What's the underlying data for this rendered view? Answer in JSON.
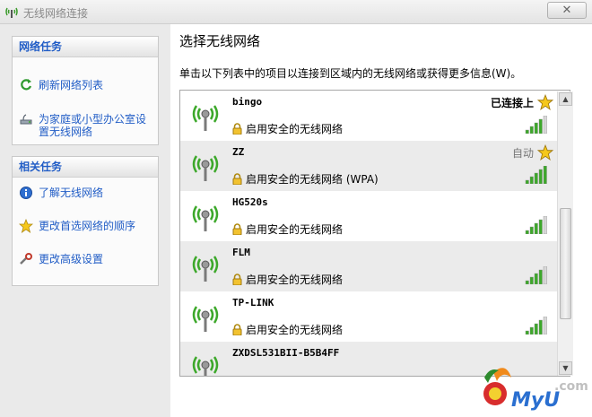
{
  "window": {
    "title": "无线网络连接",
    "close_label": "✕"
  },
  "sidebar": {
    "network_tasks": {
      "heading": "网络任务",
      "items": [
        {
          "label": "刷新网络列表",
          "icon": "refresh-icon"
        },
        {
          "label": "为家庭或小型办公室设置无线网络",
          "icon": "setup-network-icon"
        }
      ]
    },
    "related_tasks": {
      "heading": "相关任务",
      "items": [
        {
          "label": "了解无线网络",
          "icon": "info-icon"
        },
        {
          "label": "更改首选网络的顺序",
          "icon": "star-icon"
        },
        {
          "label": "更改高级设置",
          "icon": "settings-icon"
        }
      ]
    }
  },
  "main": {
    "heading": "选择无线网络",
    "description": "单击以下列表中的项目以连接到区域内的无线网络或获得更多信息(W)。",
    "networks": [
      {
        "ssid": "bingo",
        "security": "启用安全的无线网络",
        "status": "已连接上",
        "starred": true,
        "signal": 4
      },
      {
        "ssid": "ZZ",
        "security": "启用安全的无线网络 (WPA)",
        "status": "自动",
        "starred": true,
        "signal": 5
      },
      {
        "ssid": "HG520s",
        "security": "启用安全的无线网络",
        "status": "",
        "starred": false,
        "signal": 4
      },
      {
        "ssid": "FLM",
        "security": "启用安全的无线网络",
        "status": "",
        "starred": false,
        "signal": 4
      },
      {
        "ssid": "TP-LINK",
        "security": "启用安全的无线网络",
        "status": "",
        "starred": false,
        "signal": 4
      },
      {
        "ssid": "ZXDSL531BII-B5B4FF",
        "security": "",
        "status": "",
        "starred": false,
        "signal": 0
      }
    ]
  },
  "colors": {
    "link": "#215dc6",
    "signal_green": "#3ca82a",
    "star_yellow": "#f6c81a"
  }
}
